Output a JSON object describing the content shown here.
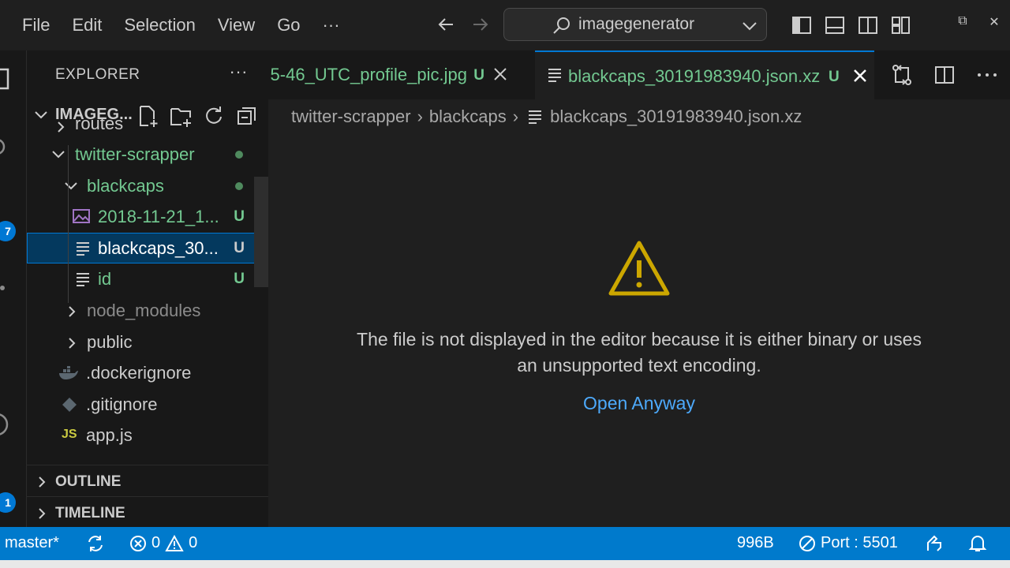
{
  "menu": [
    "File",
    "Edit",
    "Selection",
    "View",
    "Go",
    "···"
  ],
  "search": {
    "text": "imagegenerator"
  },
  "window_controls": [
    "⧉",
    "✕"
  ],
  "activity": {
    "badges": [
      "7",
      "1"
    ]
  },
  "sidebar": {
    "title": "EXPLORER",
    "more": "···",
    "folder": "IMAGEG...",
    "tree": [
      {
        "label": "routes",
        "kind": "folder-collapsed"
      },
      {
        "label": "twitter-scrapper",
        "kind": "folder-open"
      },
      {
        "label": "blackcaps",
        "kind": "folder-open"
      },
      {
        "label": "2018-11-21_1...",
        "kind": "image",
        "status": "U"
      },
      {
        "label": "blackcaps_30...",
        "kind": "file",
        "status": "U",
        "selected": true
      },
      {
        "label": "id",
        "kind": "file",
        "status": "U"
      },
      {
        "label": "node_modules",
        "kind": "folder-collapsed"
      },
      {
        "label": "public",
        "kind": "folder-collapsed"
      },
      {
        "label": ".dockerignore",
        "kind": "docker"
      },
      {
        "label": ".gitignore",
        "kind": "git"
      },
      {
        "label": "app.js",
        "kind": "js",
        "badge": "JS"
      }
    ],
    "sections": [
      "OUTLINE",
      "TIMELINE"
    ]
  },
  "tabs": [
    {
      "label": "5-46_UTC_profile_pic.jpg",
      "status": "U",
      "active": false
    },
    {
      "label": "blackcaps_30191983940.json.xz",
      "status": "U",
      "active": true
    }
  ],
  "breadcrumb": [
    "twitter-scrapper",
    "blackcaps",
    "blackcaps_30191983940.json.xz"
  ],
  "editor": {
    "message_line1": "The file is not displayed in the editor because it is either binary or uses",
    "message_line2": "an unsupported text encoding.",
    "action": "Open Anyway"
  },
  "status": {
    "branch": "master*",
    "errors": "0",
    "warnings": "0",
    "size": "996B",
    "port": "Port : 5501"
  },
  "colors": {
    "accent": "#007acc",
    "untracked": "#73c991",
    "link": "#4daafc",
    "warning": "#cca700"
  }
}
